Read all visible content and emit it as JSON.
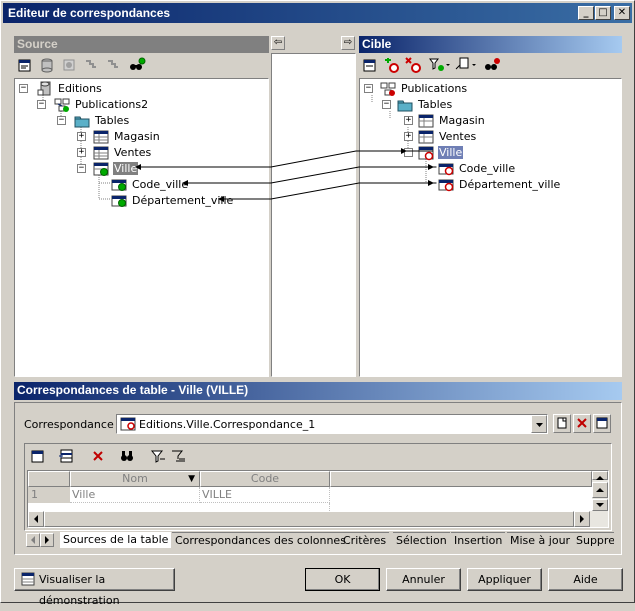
{
  "window": {
    "title": "Editeur de correspondances"
  },
  "titlebar_buttons": {
    "minimize": "_",
    "maximize": "□",
    "close": "✕"
  },
  "source": {
    "header": "Source",
    "tree": {
      "root": "Editions",
      "model": "Publications2",
      "folder": "Tables",
      "items": [
        "Magasin",
        "Ventes",
        "Ville"
      ],
      "columns": [
        "Code_ville",
        "Département_ville"
      ]
    }
  },
  "middle": {
    "left_arrow": "⇦",
    "right_arrow": "⇨"
  },
  "target": {
    "header": "Cible",
    "tree": {
      "root": "Publications",
      "folder": "Tables",
      "items": [
        "Magasin",
        "Ventes",
        "Ville"
      ],
      "columns": [
        "Code_ville",
        "Département_ville"
      ]
    }
  },
  "mapping": {
    "header": "Correspondances de table - Ville (VILLE)",
    "label": "Correspondance :",
    "value": "Editions.Ville.Correspondance_1"
  },
  "grid": {
    "columns": [
      "Nom",
      "Code"
    ],
    "rows": [
      {
        "num": "1",
        "nom": "Ville",
        "code": "VILLE"
      }
    ]
  },
  "tabs": [
    "Sources de la table",
    "Correspondances des colonnes",
    "Critères",
    "Sélection",
    "Insertion",
    "Mise à jour",
    "Suppre"
  ],
  "buttons": {
    "demo": "Visualiser la démonstration",
    "ok": "OK",
    "cancel": "Annuler",
    "apply": "Appliquer",
    "help": "Aide"
  },
  "colors": {
    "title": "#0a246a",
    "selection": "#6f7fb5",
    "delete": "#c00000"
  }
}
